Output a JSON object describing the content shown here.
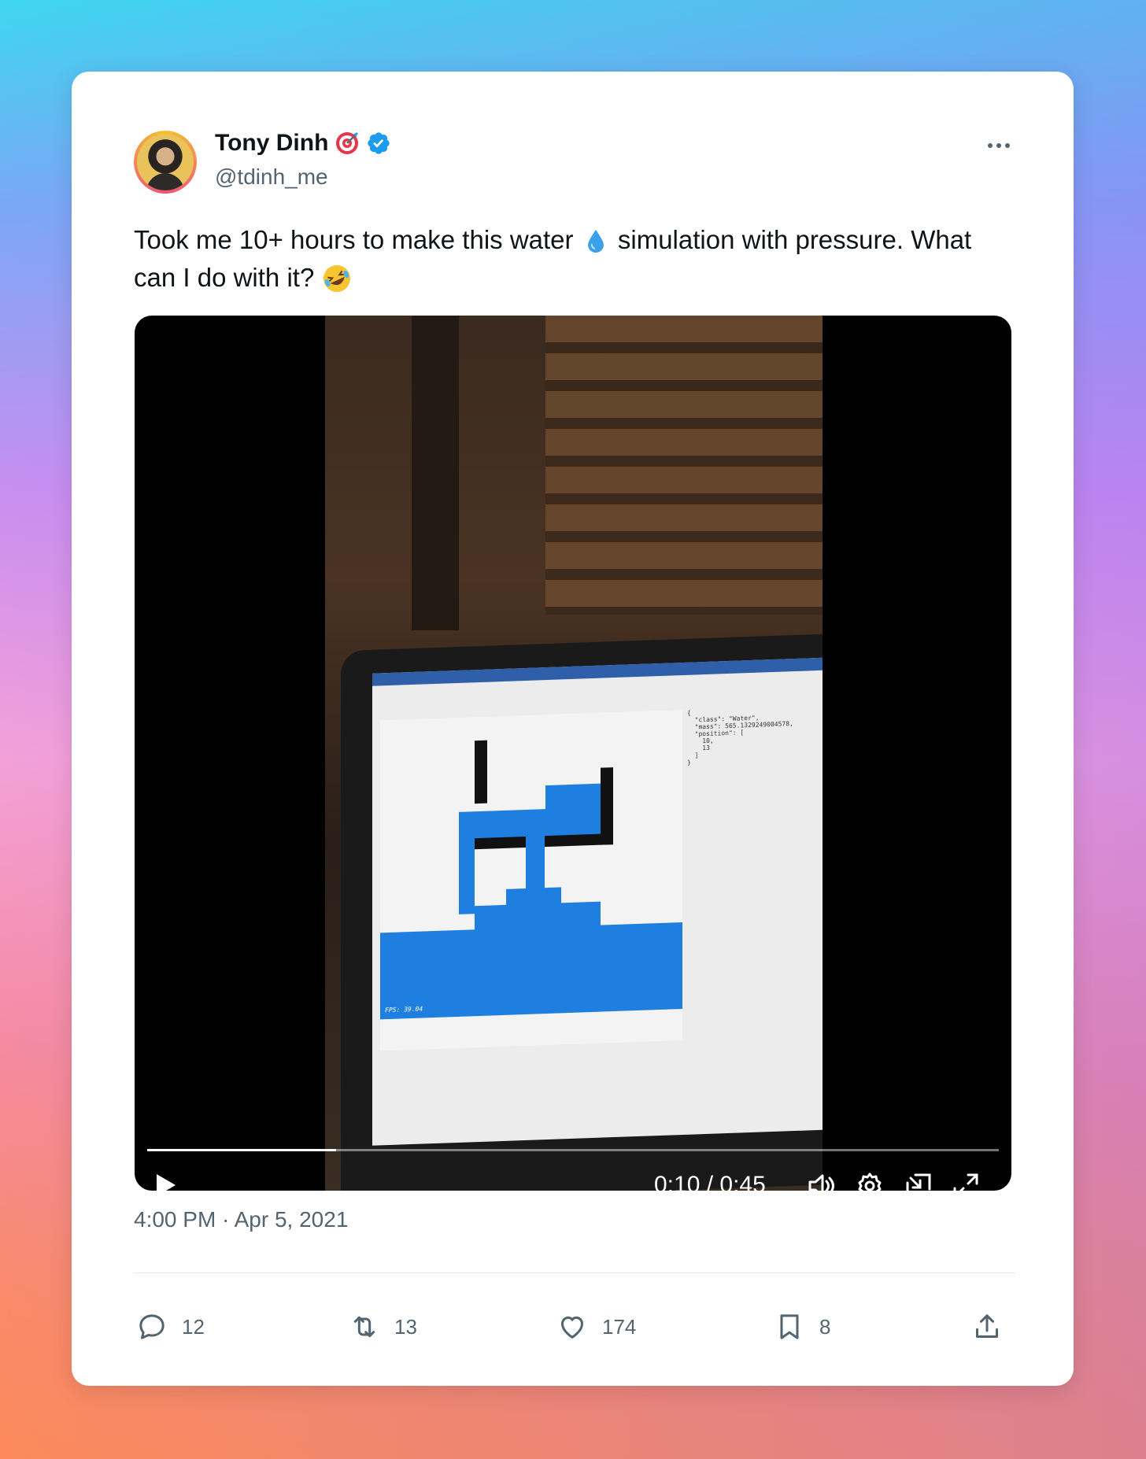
{
  "tweet": {
    "author_name": "Tony Dinh",
    "author_handle": "@tdinh_me",
    "text_part1": "Took me 10+ hours to make this water",
    "text_part2": "simulation with pressure. What can I do with it?",
    "timestamp": "4:00 PM · Apr 5, 2021"
  },
  "video": {
    "time_display": "0:10 / 0:45",
    "progress": 0.222,
    "fps_label": "FPS: 39.04",
    "json_snippet": "{\n  \"class\": \"Water\",\n  \"mass\": 565.1329249004578,\n  \"position\": [\n    10,\n    13\n  ]\n}"
  },
  "actions": {
    "replies": "12",
    "reposts": "13",
    "likes": "174",
    "bookmarks": "8"
  },
  "icons": {
    "verified": "verified-badge-icon",
    "target": "direct-hit-emoji",
    "drop": "droplet-emoji",
    "laugh": "rolling-laughing-emoji"
  },
  "colors": {
    "verified": "#1d9bf0",
    "text_primary": "#0f1419",
    "text_secondary": "#536471",
    "water": "#1f7fe0"
  }
}
